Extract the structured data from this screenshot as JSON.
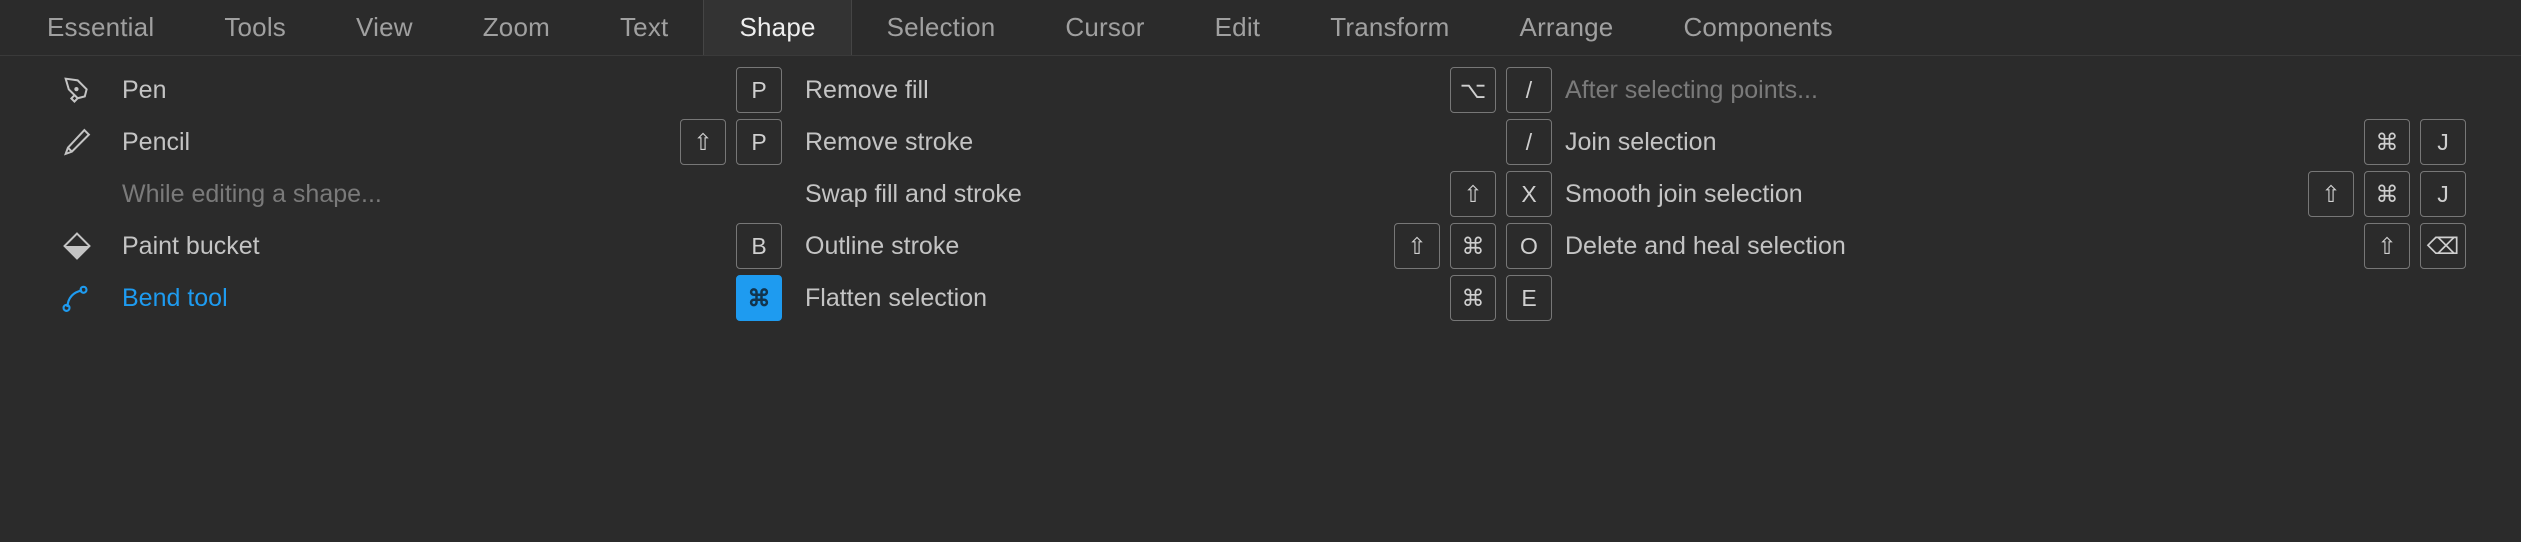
{
  "tabs": [
    {
      "label": "Essential",
      "active": false
    },
    {
      "label": "Tools",
      "active": false
    },
    {
      "label": "View",
      "active": false
    },
    {
      "label": "Zoom",
      "active": false
    },
    {
      "label": "Text",
      "active": false
    },
    {
      "label": "Shape",
      "active": true
    },
    {
      "label": "Selection",
      "active": false
    },
    {
      "label": "Cursor",
      "active": false
    },
    {
      "label": "Edit",
      "active": false
    },
    {
      "label": "Transform",
      "active": false
    },
    {
      "label": "Arrange",
      "active": false
    },
    {
      "label": "Components",
      "active": false
    }
  ],
  "colors": {
    "background": "#2b2b2b",
    "tab_active_background": "#333333",
    "accent": "#1e9bf0",
    "label": "#c4c4c4",
    "muted_label": "#7a7a7a",
    "key_border": "#777777"
  },
  "columns": [
    {
      "name": "tools-column",
      "rows": [
        {
          "type": "item",
          "icon": "pen-icon",
          "label": "Pen",
          "keys": [
            "P"
          ],
          "highlight": false
        },
        {
          "type": "item",
          "icon": "pencil-icon",
          "label": "Pencil",
          "keys": [
            "⇧",
            "P"
          ],
          "highlight": false
        },
        {
          "type": "section",
          "icon": null,
          "label": "While editing a shape...",
          "keys": [],
          "highlight": false
        },
        {
          "type": "item",
          "icon": "paint-bucket-icon",
          "label": "Paint bucket",
          "keys": [
            "B"
          ],
          "highlight": false
        },
        {
          "type": "item",
          "icon": "bend-tool-icon",
          "label": "Bend tool",
          "keys": [
            "⌘"
          ],
          "highlight": true
        }
      ]
    },
    {
      "name": "fill-stroke-column",
      "rows": [
        {
          "type": "item",
          "icon": null,
          "label": "Remove fill",
          "keys": [
            "⌥",
            "/"
          ],
          "highlight": false
        },
        {
          "type": "item",
          "icon": null,
          "label": "Remove stroke",
          "keys": [
            "/"
          ],
          "highlight": false
        },
        {
          "type": "item",
          "icon": null,
          "label": "Swap fill and stroke",
          "keys": [
            "⇧",
            "X"
          ],
          "highlight": false
        },
        {
          "type": "item",
          "icon": null,
          "label": "Outline stroke",
          "keys": [
            "⇧",
            "⌘",
            "O"
          ],
          "highlight": false
        },
        {
          "type": "item",
          "icon": null,
          "label": "Flatten selection",
          "keys": [
            "⌘",
            "E"
          ],
          "highlight": false
        }
      ]
    },
    {
      "name": "points-column",
      "rows": [
        {
          "type": "section",
          "icon": null,
          "label": "After selecting points...",
          "keys": [],
          "highlight": false
        },
        {
          "type": "item",
          "icon": null,
          "label": "Join selection",
          "keys": [
            "⌘",
            "J"
          ],
          "highlight": false
        },
        {
          "type": "item",
          "icon": null,
          "label": "Smooth join selection",
          "keys": [
            "⇧",
            "⌘",
            "J"
          ],
          "highlight": false
        },
        {
          "type": "item",
          "icon": null,
          "label": "Delete and heal selection",
          "keys": [
            "⇧",
            "⌫"
          ],
          "highlight": false
        },
        {
          "type": "blank",
          "icon": null,
          "label": "",
          "keys": [],
          "highlight": false
        }
      ]
    }
  ]
}
